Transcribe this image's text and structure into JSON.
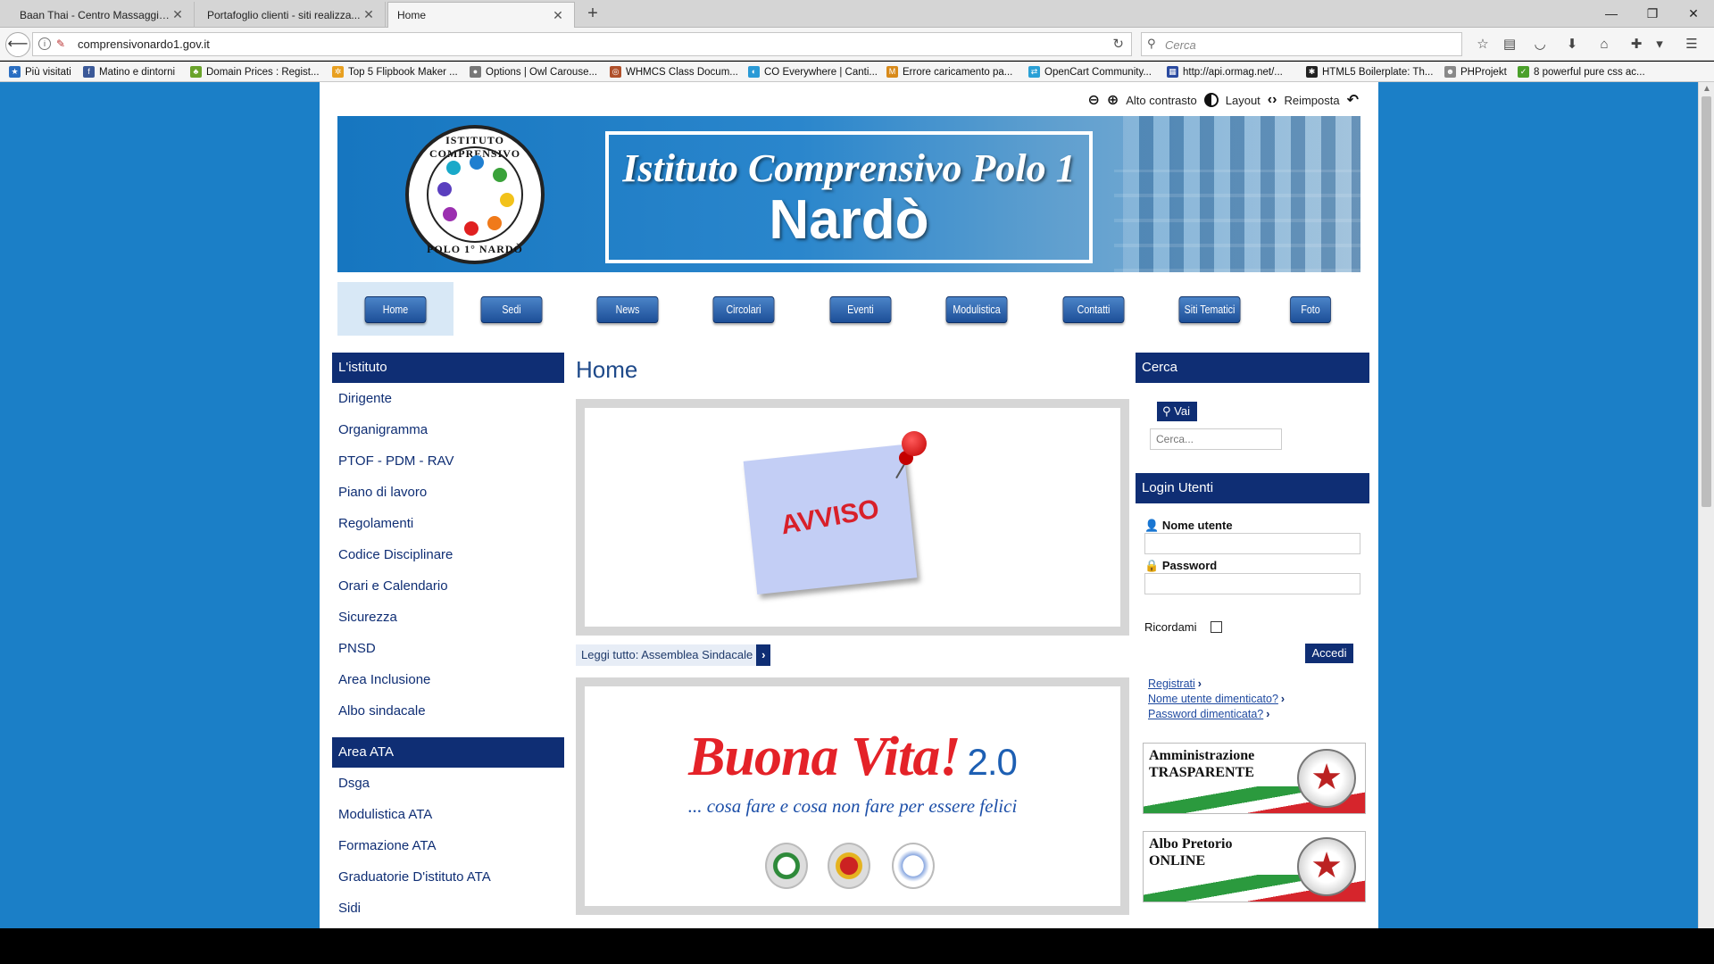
{
  "browser": {
    "tabs": [
      {
        "title": "Baan Thai - Centro Massaggi ...",
        "active": false
      },
      {
        "title": "Portafoglio clienti - siti realizza...",
        "active": false
      },
      {
        "title": "Home",
        "active": true
      }
    ],
    "new_tab_glyph": "+",
    "url": "comprensivonardo1.gov.it",
    "search_placeholder": "Cerca",
    "bookmarks": [
      {
        "label": "Più visitati",
        "icon": "bookmark-star-icon",
        "color": "#2b6fc2"
      },
      {
        "label": "Matino e dintorni",
        "icon": "facebook-icon",
        "color": "#3b5998"
      },
      {
        "label": "Domain Prices : Regist...",
        "icon": "leaf-icon",
        "color": "#6aa32b"
      },
      {
        "label": "Top 5 Flipbook Maker ...",
        "icon": "pinwheel-icon",
        "color": "#e8a020"
      },
      {
        "label": "Options | Owl Carouse...",
        "icon": "owl-icon",
        "color": "#777777"
      },
      {
        "label": "WHMCS Class Docum...",
        "icon": "whmcs-icon",
        "color": "#b0502a"
      },
      {
        "label": "CO Everywhere | Canti...",
        "icon": "cloud-icon",
        "color": "#2a9ad6"
      },
      {
        "label": "Errore caricamento pa...",
        "icon": "mt-icon",
        "color": "#d88a1a"
      },
      {
        "label": "OpenCart Community...",
        "icon": "opencart-icon",
        "color": "#2aa0d6"
      },
      {
        "label": "http://api.ormag.net/...",
        "icon": "flag-icon",
        "color": "#2a4aa0"
      },
      {
        "label": "HTML5 Boilerplate: Th...",
        "icon": "html5-icon",
        "color": "#222222"
      },
      {
        "label": "PHProjekt",
        "icon": "phprojekt-icon",
        "color": "#888888"
      },
      {
        "label": "8 powerful pure css ac...",
        "icon": "css-icon",
        "color": "#4aa02a"
      }
    ]
  },
  "accessibility": {
    "contrast_label": "Alto contrasto",
    "layout_label": "Layout",
    "reset_label": "Reimposta"
  },
  "banner": {
    "seal_top": "ISTITUTO COMPRENSIVO",
    "seal_bottom": "POLO 1° NARDÒ",
    "title_line1": "Istituto Comprensivo Polo 1",
    "title_line2": "Nardò"
  },
  "nav": [
    "Home",
    "Sedi",
    "News",
    "Circolari",
    "Eventi",
    "Modulistica",
    "Contatti",
    "Siti Tematici",
    "Foto"
  ],
  "left_sidebar": {
    "section1_title": "L'istituto",
    "section1_links": [
      "Dirigente",
      "Organigramma",
      "PTOF - PDM - RAV",
      "Piano di lavoro",
      "Regolamenti",
      "Codice Disciplinare",
      "Orari e Calendario",
      "Sicurezza",
      "PNSD",
      "Area Inclusione",
      "Albo sindacale"
    ],
    "section2_title": "Area ATA",
    "section2_links": [
      "Dsga",
      "Modulistica ATA",
      "Formazione ATA",
      "Graduatorie D'istituto ATA",
      "Sidi"
    ]
  },
  "main": {
    "title": "Home",
    "avviso_text": "AVVISO",
    "readmore": "Leggi tutto: Assemblea Sindacale",
    "buona_title": "Buona Vita!",
    "buona_version": "2.0",
    "buona_subtitle": "... cosa fare e cosa non fare per essere felici"
  },
  "right_sidebar": {
    "search_title": "Cerca",
    "search_button": "Vai",
    "search_placeholder": "Cerca...",
    "login_title": "Login Utenti",
    "username_label": "Nome utente",
    "password_label": "Password",
    "remember_label": "Ricordami",
    "login_button": "Accedi",
    "links": [
      "Registrati",
      "Nome utente dimenticato?",
      "Password dimenticata?"
    ],
    "banner1_line1": "Amministrazione",
    "banner1_line2": "TRASPARENTE",
    "banner2_line1": "Albo Pretorio",
    "banner2_line2": "ONLINE"
  },
  "colors": {
    "page_bg": "#1b7fc7",
    "navy": "#0f2e74",
    "accent_red": "#e42228"
  }
}
